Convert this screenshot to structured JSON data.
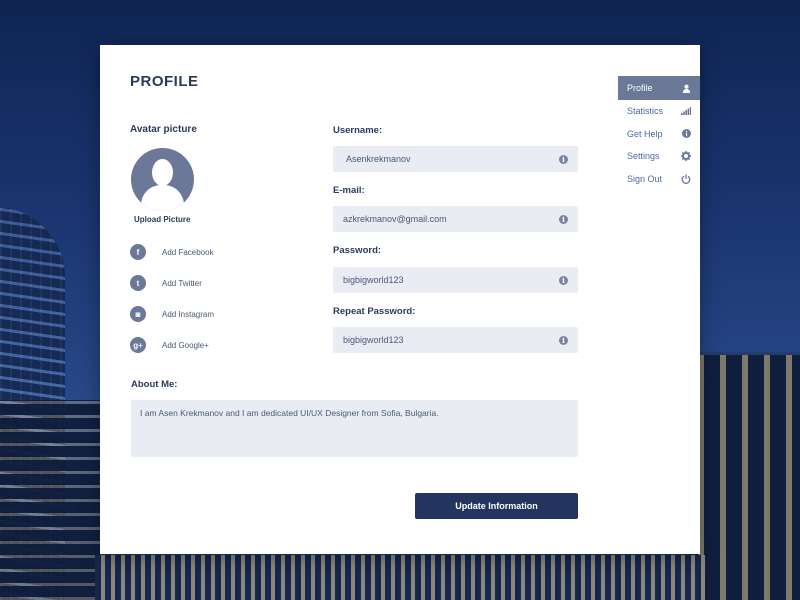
{
  "page": {
    "title": "PROFILE"
  },
  "avatar": {
    "label": "Avatar picture",
    "upload_label": "Upload Picture"
  },
  "social": [
    {
      "label": "Add Facebook",
      "icon": "facebook-icon",
      "glyph": "f"
    },
    {
      "label": "Add Twitter",
      "icon": "twitter-icon",
      "glyph": "t"
    },
    {
      "label": "Add Instagram",
      "icon": "instagram-icon",
      "glyph": "◙"
    },
    {
      "label": "Add Google+",
      "icon": "google-plus-icon",
      "glyph": "g+"
    }
  ],
  "form": {
    "username": {
      "label": "Username:",
      "value": "Asenkrekmanov"
    },
    "email": {
      "label": "E-mail:",
      "value": "azkrekmanov@gmail.com"
    },
    "password": {
      "label": "Password:",
      "value": "bigbigworld123"
    },
    "repeat_password": {
      "label": "Repeat Password:",
      "value": "bigbigworld123"
    },
    "about": {
      "label": "About Me:",
      "value": "I am Asen Krekmanov and I am dedicated UI/UX Designer from Sofia, Bulgaria."
    },
    "submit_label": "Update Information"
  },
  "menu": [
    {
      "label": "Profile",
      "icon": "user-icon",
      "active": true
    },
    {
      "label": "Statistics",
      "icon": "bars-icon",
      "active": false
    },
    {
      "label": "Get Help",
      "icon": "info-icon",
      "active": false
    },
    {
      "label": "Settings",
      "icon": "gear-icon",
      "active": false
    },
    {
      "label": "Sign Out",
      "icon": "power-icon",
      "active": false
    }
  ],
  "colors": {
    "accent": "#23355f",
    "menu_active": "#6c7898",
    "field_bg": "#e9ecf2"
  }
}
